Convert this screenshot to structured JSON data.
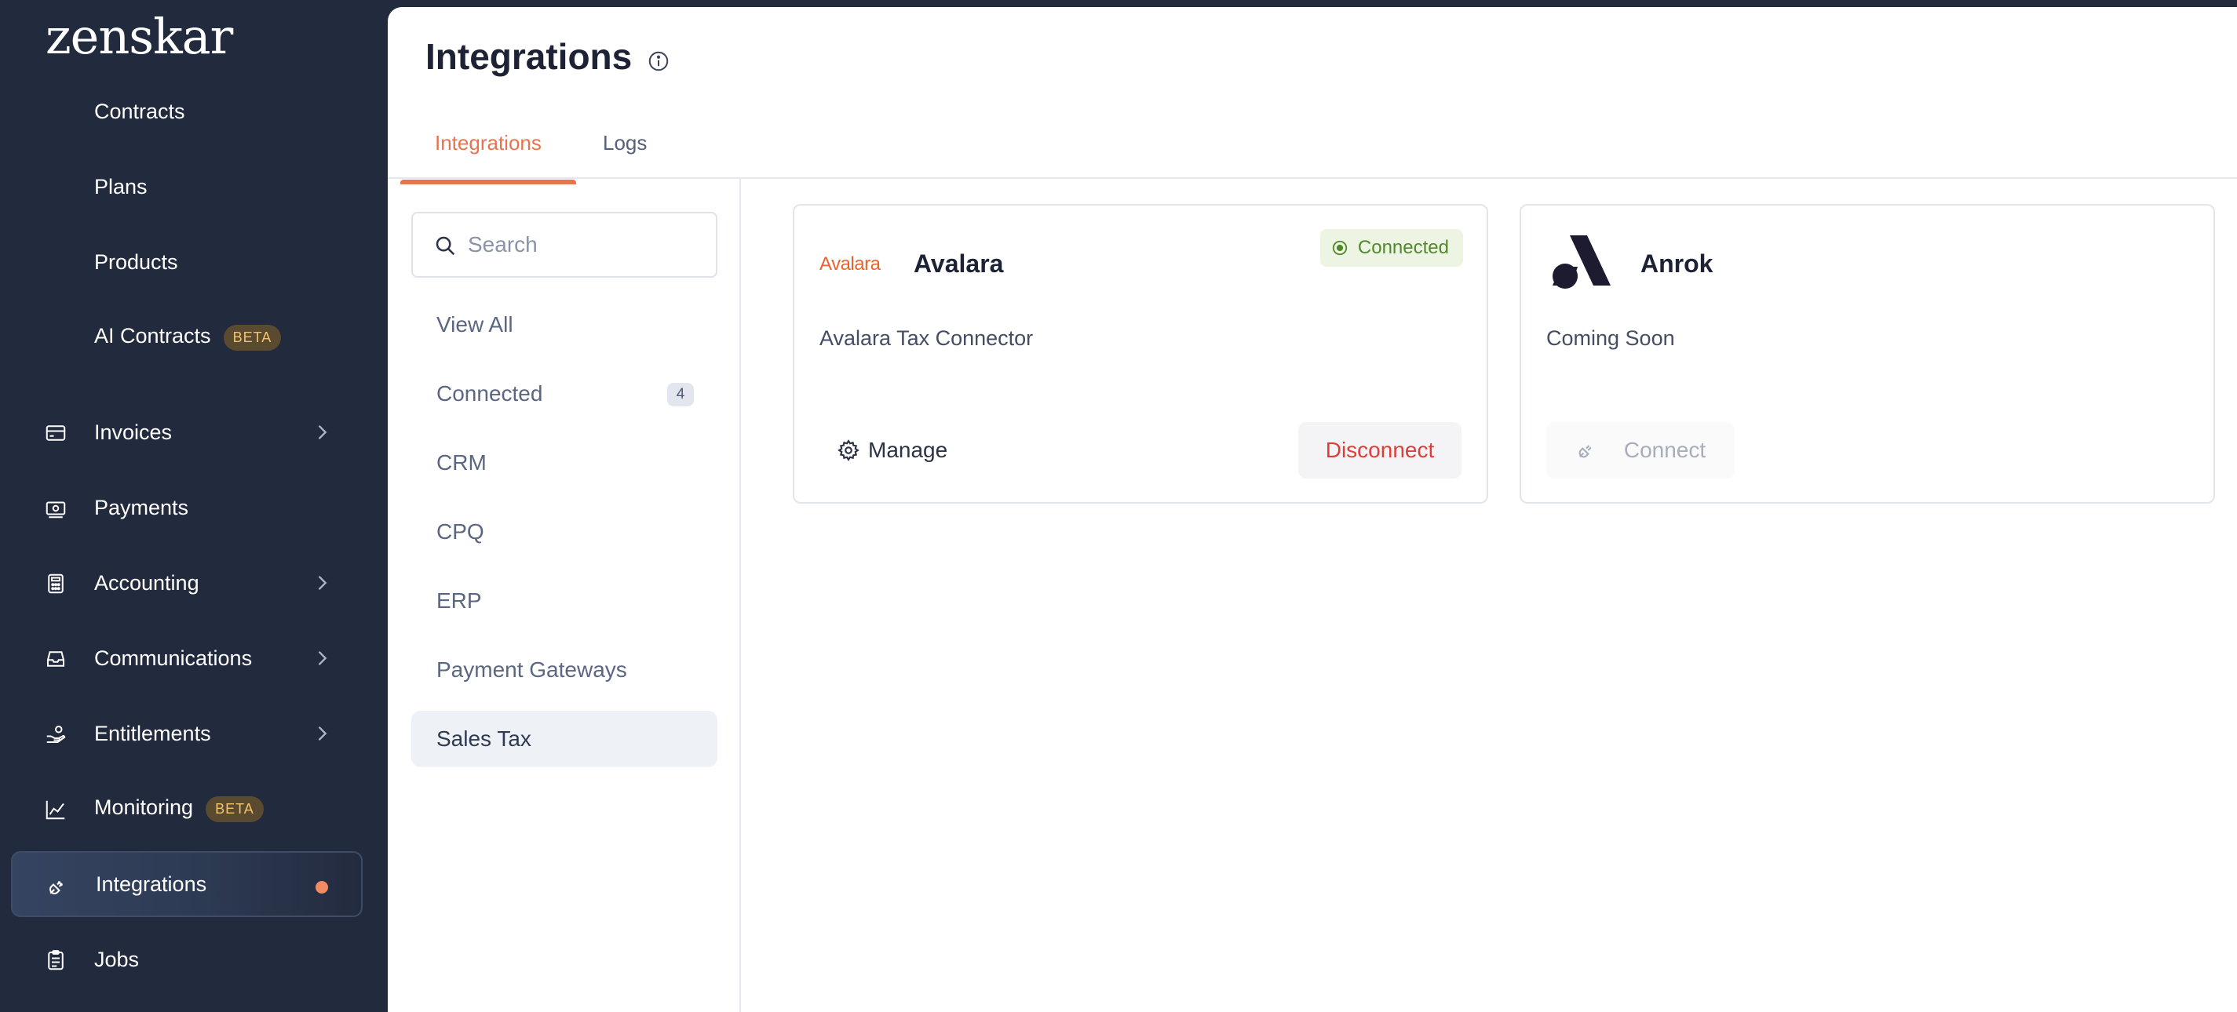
{
  "brand": {
    "logo_text": "zenskar"
  },
  "sidebar": {
    "items": [
      {
        "label": "Contracts"
      },
      {
        "label": "Plans"
      },
      {
        "label": "Products"
      },
      {
        "label": "AI Contracts",
        "badge": "BETA"
      },
      {
        "label": "Invoices",
        "icon": "invoice-icon",
        "expandable": true
      },
      {
        "label": "Payments",
        "icon": "payments-icon"
      },
      {
        "label": "Accounting",
        "icon": "calculator-icon",
        "expandable": true
      },
      {
        "label": "Communications",
        "icon": "inbox-icon",
        "expandable": true
      },
      {
        "label": "Entitlements",
        "icon": "entitlements-icon",
        "expandable": true
      },
      {
        "label": "Monitoring",
        "icon": "chart-line-icon",
        "badge": "BETA"
      },
      {
        "label": "Integrations",
        "icon": "plug-icon",
        "active": true
      },
      {
        "label": "Jobs",
        "icon": "clipboard-icon"
      }
    ]
  },
  "header": {
    "title": "Integrations",
    "tabs": [
      {
        "label": "Integrations",
        "active": true
      },
      {
        "label": "Logs",
        "active": false
      }
    ]
  },
  "filters": {
    "search_placeholder": "Search",
    "search_value": "",
    "items": [
      {
        "label": "View All"
      },
      {
        "label": "Connected",
        "count": "4"
      },
      {
        "label": "CRM"
      },
      {
        "label": "CPQ"
      },
      {
        "label": "ERP"
      },
      {
        "label": "Payment Gateways"
      },
      {
        "label": "Sales Tax",
        "selected": true
      }
    ]
  },
  "cards": [
    {
      "logo_text": "Avalara",
      "name": "Avalara",
      "description": "Avalara Tax Connector",
      "status": "Connected",
      "manage_label": "Manage",
      "disconnect_label": "Disconnect"
    },
    {
      "name": "Anrok",
      "description": "Coming Soon",
      "connect_label": "Connect"
    }
  ],
  "colors": {
    "sidebar_bg": "#222a3d",
    "accent": "#e7744e",
    "connected": "#4f8a2b",
    "danger": "#de3e3a",
    "active_dot": "#f08b62",
    "beta_text": "#f3c36b"
  }
}
